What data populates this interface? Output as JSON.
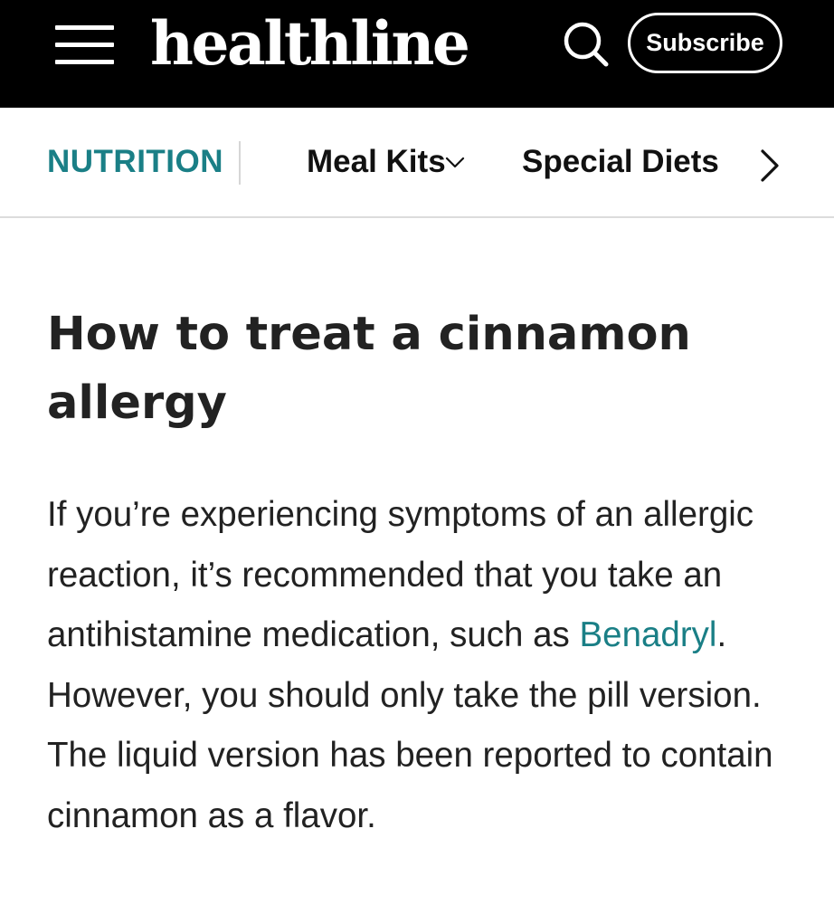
{
  "header": {
    "logo_text": "healthline",
    "menu_icon": "hamburger-menu-icon",
    "search_icon": "search-icon",
    "subscribe_label": "Subscribe"
  },
  "subnav": {
    "section": "NUTRITION",
    "items": [
      {
        "label": "Meal Kits",
        "has_dropdown": true
      },
      {
        "label": "Special Diets",
        "has_dropdown": false
      }
    ],
    "next_icon": "chevron-right-icon"
  },
  "article": {
    "heading": "How to treat a cinnamon allergy",
    "paragraph": {
      "before_link": "If you’re experiencing symptoms of an allergic reaction, it’s recommended that you take an antihistamine medication, such as ",
      "link_text": "Benadryl",
      "after_link": ". However, you should only take the pill version. The liquid version has been reported to contain cinnamon as a flavor."
    }
  },
  "colors": {
    "header_bg": "#000000",
    "accent_teal": "#1a7f86",
    "text": "#222222"
  }
}
